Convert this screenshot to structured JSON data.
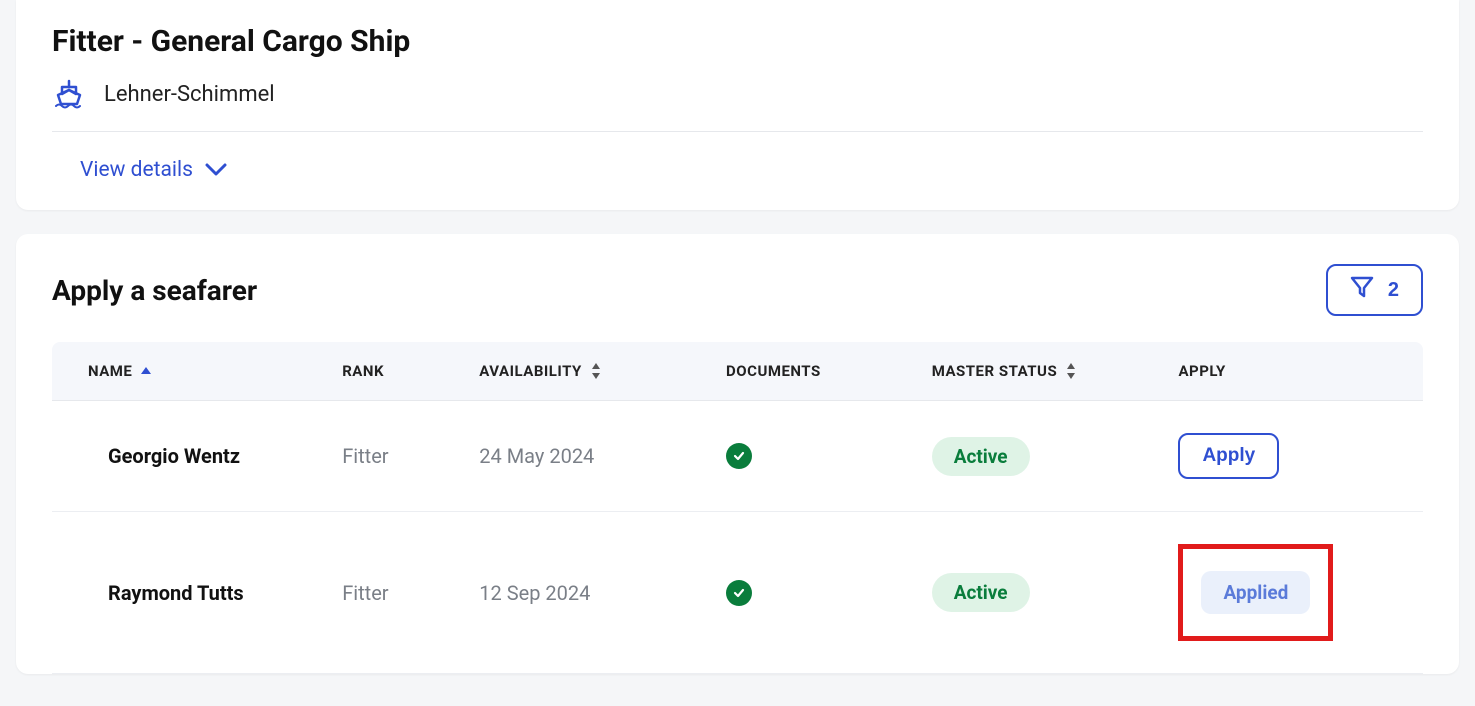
{
  "header": {
    "title": "Fitter - General Cargo Ship",
    "company": "Lehner-Schimmel",
    "view_details": "View details"
  },
  "seafarer_section": {
    "title": "Apply a seafarer",
    "filter_count": "2",
    "columns": {
      "name": "NAME",
      "rank": "RANK",
      "availability": "AVAILABILITY",
      "documents": "DOCUMENTS",
      "master_status": "MASTER STATUS",
      "apply": "APPLY"
    },
    "rows": [
      {
        "name": "Georgio Wentz",
        "rank": "Fitter",
        "availability": "24 May 2024",
        "documents_ok": true,
        "status": "Active",
        "apply_state": "apply",
        "apply_label": "Apply"
      },
      {
        "name": "Raymond Tutts",
        "rank": "Fitter",
        "availability": "12 Sep 2024",
        "documents_ok": true,
        "status": "Active",
        "apply_state": "applied",
        "apply_label": "Applied"
      }
    ]
  }
}
